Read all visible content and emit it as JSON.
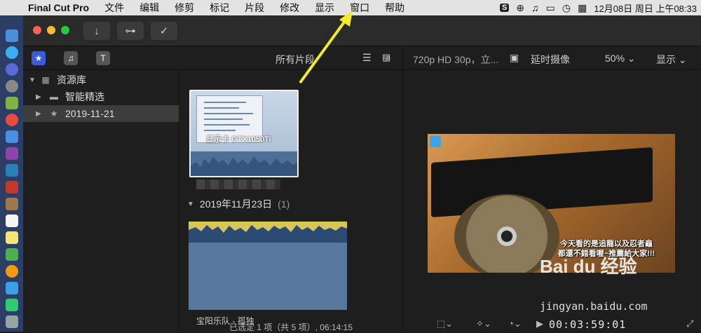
{
  "menubar": {
    "app_name": "Final Cut Pro",
    "items": [
      "文件",
      "编辑",
      "修剪",
      "标记",
      "片段",
      "修改",
      "显示",
      "窗口",
      "帮助"
    ],
    "clock": "12月08日 周日 上午08:33"
  },
  "toolbar": {
    "import_icon": "download-arrow-icon",
    "keyword_icon": "key-icon",
    "check_icon": "checkmark-icon"
  },
  "library": {
    "items": [
      {
        "label": "资源库",
        "icon": "library-grid-icon"
      },
      {
        "label": "智能精选",
        "icon": "folder-icon"
      },
      {
        "label": "2019-11-21",
        "icon": "star-event-icon"
      }
    ]
  },
  "browser": {
    "filter_label": "所有片段",
    "date_group": {
      "label": "2019年11月23日",
      "count": "(1)"
    },
    "clip1_caption": "显示卡 GTX1050Ti",
    "clip2_label": "宝阳乐队 - 孤独",
    "status": "已选定 1 项（共 5 项）, 06:14:15"
  },
  "viewer": {
    "format": "720p HD 30p，立...",
    "timelapse_label": "延时摄像",
    "zoom": "50%",
    "display_menu": "显示",
    "subtitle_line1": "今天看的是追龍以及忍者龜",
    "subtitle_line2": "都還不錯看喔~推薦給大家!!!",
    "timecode": "00:03:59:01"
  },
  "watermark": {
    "text": "Bai du 经验",
    "url": "jingyan.baidu.com"
  }
}
